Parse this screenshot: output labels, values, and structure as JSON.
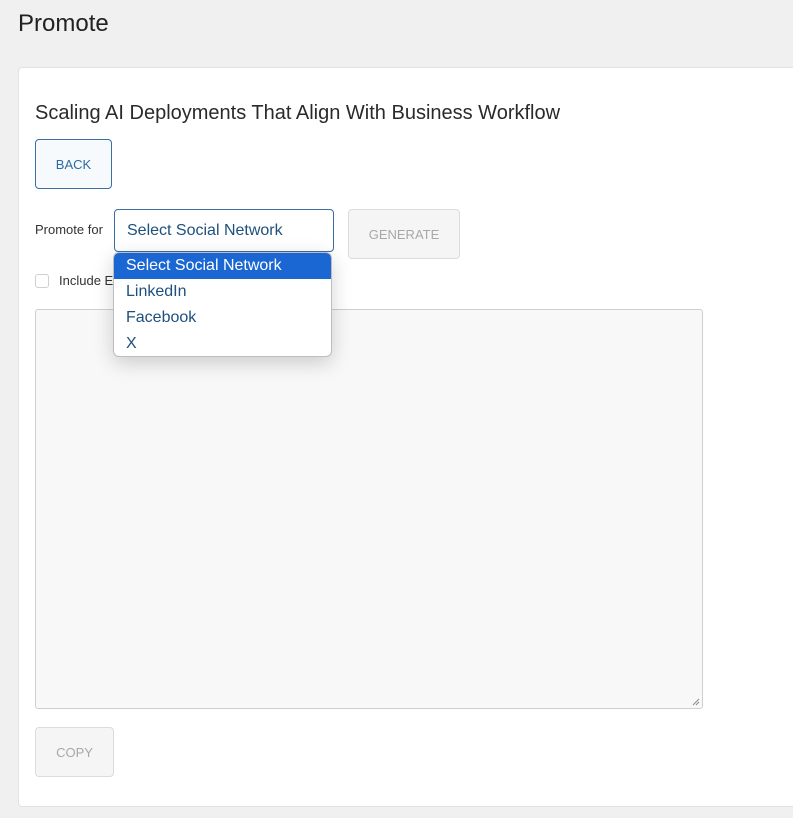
{
  "page": {
    "title": "Promote"
  },
  "article": {
    "title": "Scaling AI Deployments That Align With Business Workflow"
  },
  "buttons": {
    "back_label": "BACK",
    "generate_label": "GENERATE",
    "copy_label": "COPY"
  },
  "promote": {
    "label": "Promote for",
    "selected_value": "Select Social Network",
    "options": [
      "Select Social Network",
      "LinkedIn",
      "Facebook",
      "X"
    ]
  },
  "checkbox": {
    "label": "Include E",
    "checked": false
  },
  "output": {
    "value": ""
  },
  "colors": {
    "accent": "#3a6ea5",
    "selected_option": "#1a66d2",
    "option_text": "#1e4f7d"
  }
}
